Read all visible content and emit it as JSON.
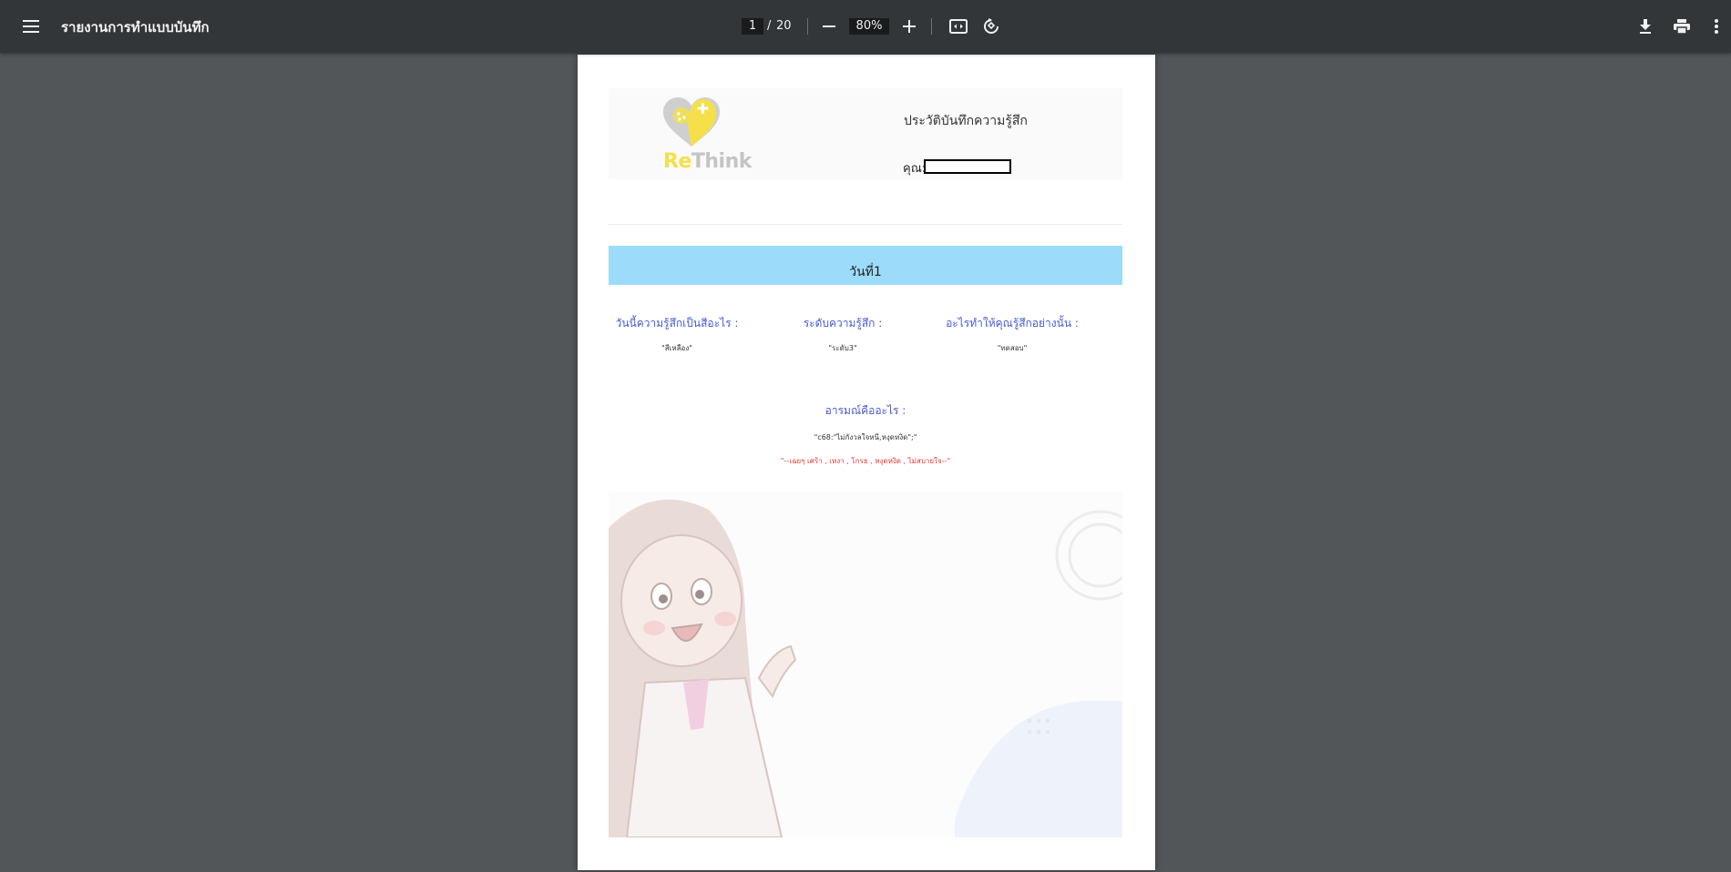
{
  "toolbar": {
    "title": "รายงานการทำแบบบันทึก",
    "page_current": "1",
    "page_separator": "/",
    "page_total": "20",
    "zoom": "80%"
  },
  "icons": {
    "menu": "menu-icon",
    "zoom_out": "minus-icon",
    "zoom_in": "plus-icon",
    "fit": "fit-to-page-icon",
    "rotate": "rotate-icon",
    "download": "download-icon",
    "print": "print-icon",
    "more": "more-vert-icon"
  },
  "document": {
    "logo_re": "Re",
    "logo_think": "Think",
    "report_title": "ประวัติบันทึกความรู้สึก",
    "name_label": "คุณ:",
    "day_label": "วันที่1",
    "columns": [
      {
        "heading": "วันนี้ความรู้สึกเป็นสีอะไร :",
        "value": "\"สีเหลือง\""
      },
      {
        "heading": "ระดับความรู้สึก :",
        "value": "\"ระดับ3\""
      },
      {
        "heading": "อะไรทำให้คุณรู้สึกอย่างนั้น :",
        "value": "\"ทดสอบ\""
      }
    ],
    "emotion_heading": "อารมณ์คืออะไร :",
    "emotion_value": "\"c68:\"ไม่กังวลใจหนี,หงุดหงิด\";\"",
    "emotion_note": "\"--เฉยๆ เศร้า , เหงา , โกรธ , หงุดหงิด , ไม่สบายใจ--\""
  },
  "colors": {
    "toolbar_bg": "#323639",
    "viewer_bg": "#525659",
    "day_bar": "#9cdcfa",
    "heading_blue": "#4a5bd4",
    "note_red": "#e53935",
    "logo_yellow": "#f5e04a"
  }
}
